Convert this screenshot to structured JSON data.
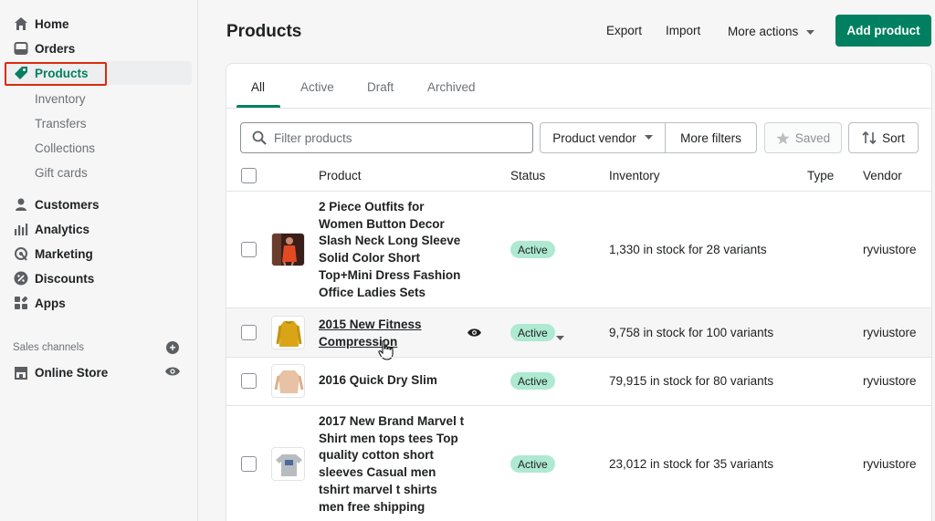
{
  "nav": {
    "home": "Home",
    "orders": "Orders",
    "products": "Products",
    "sub": [
      "Inventory",
      "Transfers",
      "Collections",
      "Gift cards"
    ],
    "customers": "Customers",
    "analytics": "Analytics",
    "marketing": "Marketing",
    "discounts": "Discounts",
    "apps": "Apps"
  },
  "sales_channels": {
    "title": "Sales channels",
    "online_store": "Online Store"
  },
  "header": {
    "title": "Products",
    "export": "Export",
    "import": "Import",
    "more_actions": "More actions",
    "add_product": "Add product"
  },
  "tabs": [
    "All",
    "Active",
    "Draft",
    "Archived"
  ],
  "filters": {
    "search_placeholder": "Filter products",
    "vendor": "Product vendor",
    "more_filters": "More filters",
    "saved": "Saved",
    "sort": "Sort"
  },
  "columns": {
    "product": "Product",
    "status": "Status",
    "inventory": "Inventory",
    "type": "Type",
    "vendor": "Vendor"
  },
  "products": [
    {
      "name": "2 Piece Outfits for Women Button Decor Slash Neck Long Sleeve Solid Color Short Top+Mini Dress Fashion Office Ladies Sets",
      "status": "Active",
      "inventory": "1,330 in stock for 28 variants",
      "vendor": "ryviustore"
    },
    {
      "name": "2015 New Fitness Compression",
      "status": "Active",
      "inventory": "9,758 in stock for 100 variants",
      "vendor": "ryviustore"
    },
    {
      "name": "2016 Quick Dry Slim",
      "status": "Active",
      "inventory": "79,915 in stock for 80 variants",
      "vendor": "ryviustore"
    },
    {
      "name": "2017 New Brand Marvel t Shirt men tops tees Top quality cotton short sleeves Casual men tshirt marvel t shirts men free shipping",
      "status": "Active",
      "inventory": "23,012 in stock for 35 variants",
      "vendor": "ryviustore"
    }
  ],
  "colors": {
    "brand": "#008060",
    "badge_active": "#aee9d1",
    "highlight": "#d72c0d"
  }
}
